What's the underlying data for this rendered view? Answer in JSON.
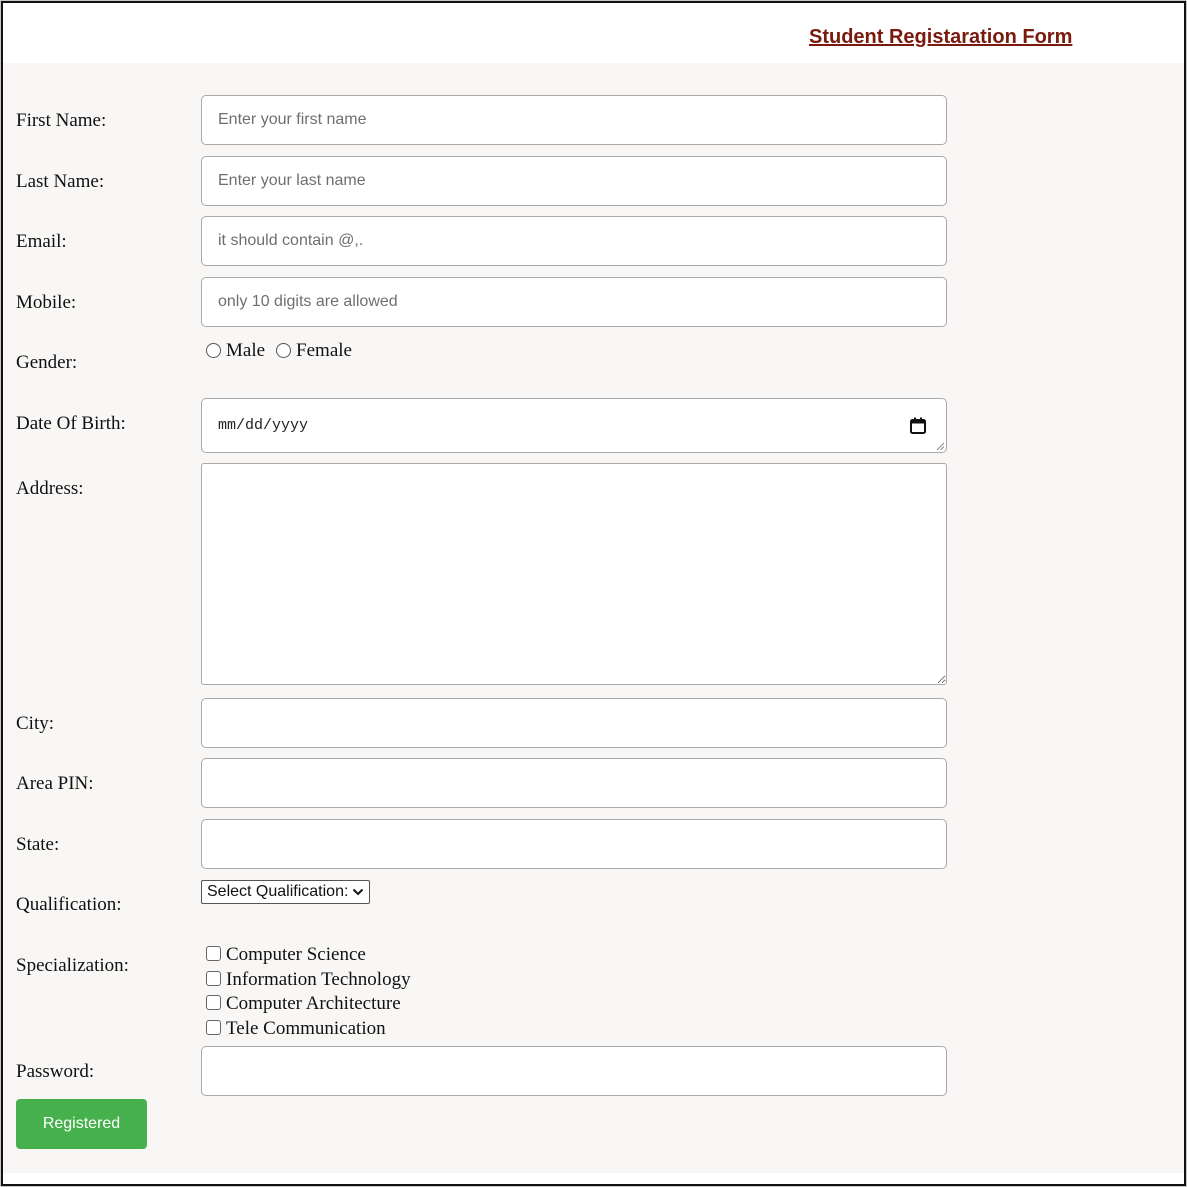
{
  "header": {
    "title": "Student Registaration Form"
  },
  "form": {
    "first_name": {
      "label": "First Name:",
      "placeholder": "Enter your first name",
      "value": ""
    },
    "last_name": {
      "label": "Last Name:",
      "placeholder": "Enter your last name",
      "value": ""
    },
    "email": {
      "label": "Email:",
      "placeholder": "it should contain @,.",
      "value": ""
    },
    "mobile": {
      "label": "Mobile:",
      "placeholder": "only 10 digits are allowed",
      "value": ""
    },
    "gender": {
      "label": "Gender:",
      "options": [
        "Male",
        "Female"
      ]
    },
    "dob": {
      "label": "Date Of Birth:",
      "placeholder": "mm/dd/yyyy",
      "icon": "calendar-icon"
    },
    "address": {
      "label": "Address:",
      "value": ""
    },
    "city": {
      "label": "City:",
      "value": ""
    },
    "pin": {
      "label": "Area PIN:",
      "value": ""
    },
    "state": {
      "label": "State:",
      "value": ""
    },
    "qualification": {
      "label": "Qualification:",
      "selected": "Select Qualification:"
    },
    "specialization": {
      "label": "Specialization:",
      "options": [
        "Computer Science",
        "Information Technology",
        "Computer Architecture",
        "Tele Communication"
      ]
    },
    "password": {
      "label": "Password:",
      "value": ""
    },
    "submit_label": "Registered"
  },
  "colors": {
    "title": "#7a1a0c",
    "button": "#46b04c",
    "form_bg": "#f8f7f6"
  }
}
